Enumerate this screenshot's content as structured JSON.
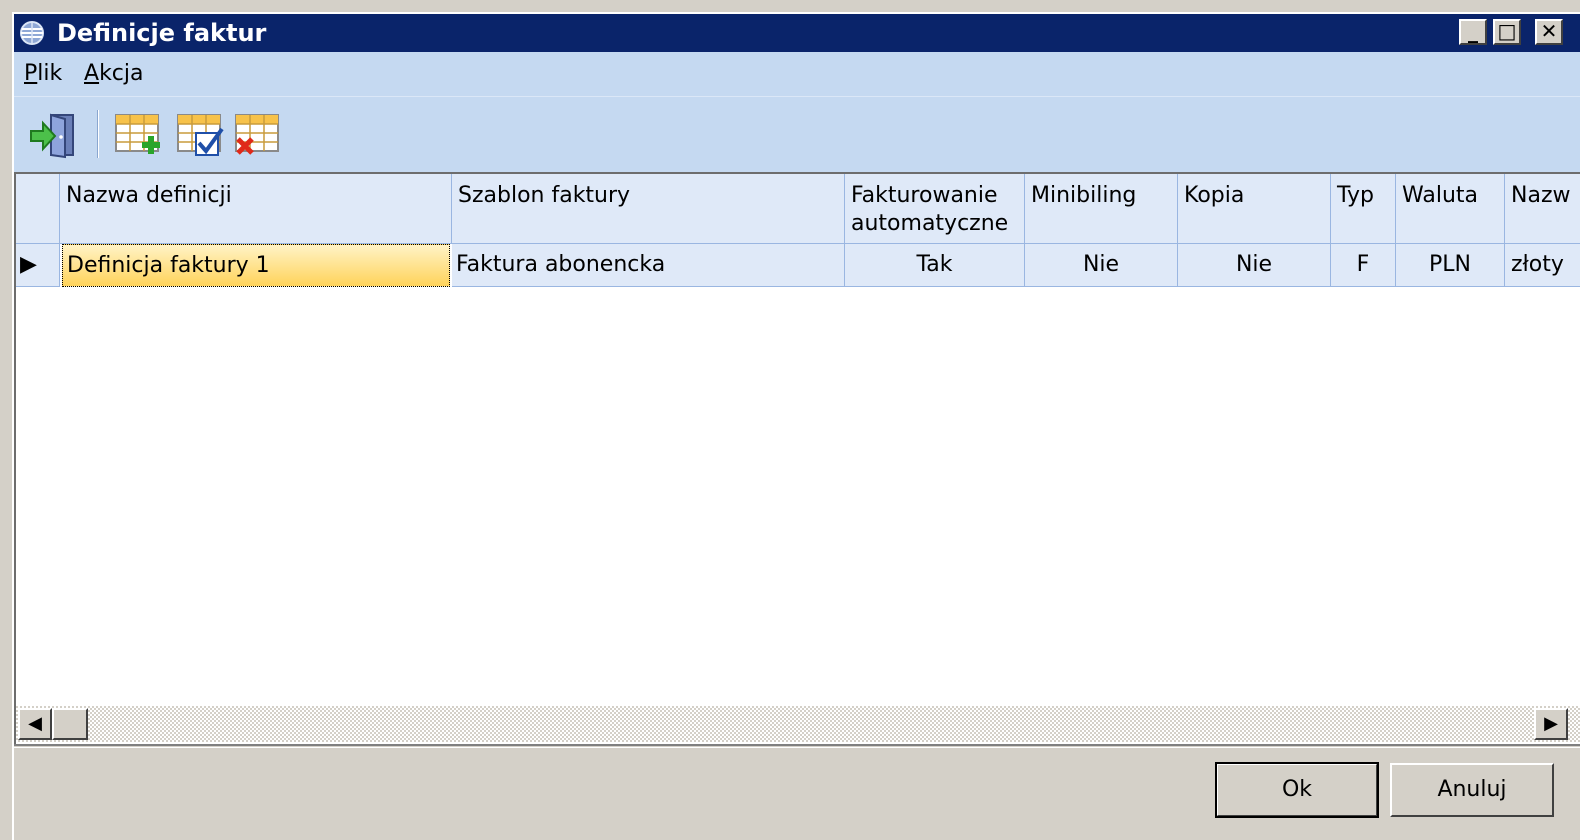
{
  "window": {
    "title": "Definicje faktur",
    "caption_buttons": {
      "minimize": "_",
      "maximize": "□",
      "close": "✕"
    }
  },
  "menu": {
    "plik": {
      "accel": "P",
      "rest": "lik"
    },
    "akcja": {
      "accel": "A",
      "rest": "kcja"
    }
  },
  "toolbar": {
    "icons": [
      "exit-door-icon",
      "add-row-icon",
      "edit-row-icon",
      "delete-row-icon"
    ]
  },
  "grid": {
    "columns": [
      "Nazwa definicji",
      "Szablon faktury",
      "Fakturowanie\nautomatyczne",
      "Minibiling",
      "Kopia",
      "Typ",
      "Waluta",
      "Nazw"
    ],
    "rows": [
      {
        "indicator": "▶",
        "cells": [
          "Definicja faktury 1",
          "Faktura abonencka",
          "Tak",
          "Nie",
          "Nie",
          "F",
          "PLN",
          "złoty"
        ]
      }
    ],
    "header_color": "#dfe9f8",
    "selection_color": "#ffd35a"
  },
  "scrollbar": {
    "left_arrow": "◀",
    "right_arrow": "▶"
  },
  "buttons": {
    "ok": "Ok",
    "cancel": "Anuluj"
  },
  "colors": {
    "titlebar": "#0a246a",
    "menubar": "#c5d9f1"
  }
}
